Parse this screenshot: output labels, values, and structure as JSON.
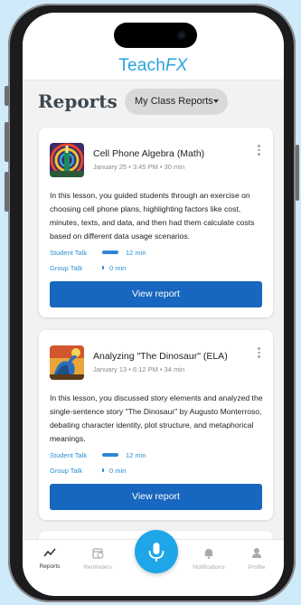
{
  "app": {
    "logo_main": "Teach",
    "logo_accent": "FX"
  },
  "header": {
    "title": "Reports",
    "filter_label": "My Class Reports"
  },
  "colors": {
    "accent": "#1fa6e8",
    "button": "#1766bf",
    "talk": "#2f86d6"
  },
  "reports": [
    {
      "title": "Cell Phone Algebra (Math)",
      "meta": "January 25 • 3:45 PM • 30 min",
      "description": "In this lesson, you guided students through an exercise on choosing cell phone plans, highlighting factors like cost, minutes, texts, and data, and then had them calculate costs based on different data usage scenarios.",
      "student_talk_label": "Student Talk",
      "student_talk_value": "12 min",
      "group_talk_label": "Group Talk",
      "group_talk_value": "0 min",
      "button_label": "View report"
    },
    {
      "title": "Analyzing \"The Dinosaur\" (ELA)",
      "meta": "January 13 • 6:12 PM • 34 min",
      "description": "In this lesson, you discussed story elements and analyzed the single-sentence story \"The Dinosaur\" by Augusto Monterroso, debating character identity, plot structure, and metaphorical meanings.",
      "student_talk_label": "Student Talk",
      "student_talk_value": "12 min",
      "group_talk_label": "Group Talk",
      "group_talk_value": "0 min",
      "button_label": "View report"
    }
  ],
  "nav": [
    {
      "label": "Reports",
      "icon": "chart-line-icon",
      "active": true
    },
    {
      "label": "Reminders",
      "icon": "calendar-clock-icon",
      "active": false
    },
    {
      "label": "Notifications",
      "icon": "bell-icon",
      "active": false
    },
    {
      "label": "Profile",
      "icon": "person-icon",
      "active": false
    }
  ],
  "record": {
    "icon": "microphone-icon"
  }
}
